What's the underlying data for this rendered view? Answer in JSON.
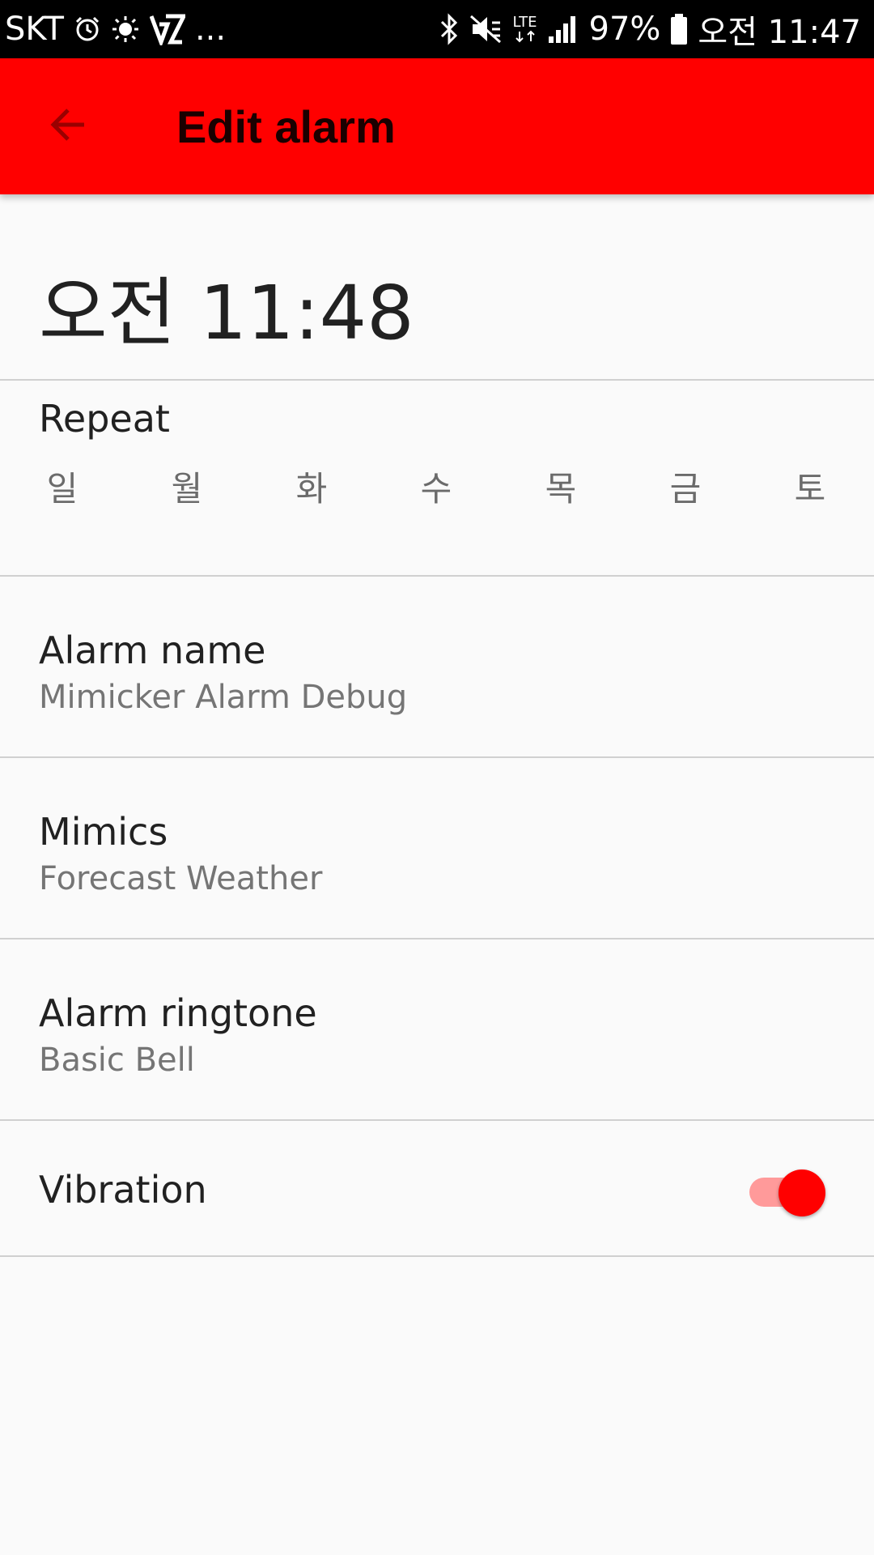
{
  "status_bar": {
    "carrier": "SKT",
    "more": "...",
    "network": "LTE",
    "battery": "97%",
    "time": "오전 11:47",
    "icons": [
      "alarm-icon",
      "brightness-icon",
      "app-icon",
      "bluetooth-icon",
      "mute-icon",
      "lte-icon",
      "signal-icon",
      "battery-icon"
    ]
  },
  "app_bar": {
    "title": "Edit alarm",
    "back_icon": "arrow-back-icon",
    "color": "#ff0000"
  },
  "alarm_time": "오전 11:48",
  "repeat": {
    "label": "Repeat",
    "days": [
      "일",
      "월",
      "화",
      "수",
      "목",
      "금",
      "토"
    ]
  },
  "alarm_name": {
    "title": "Alarm name",
    "value": "Mimicker Alarm Debug"
  },
  "mimics": {
    "title": "Mimics",
    "value": "Forecast Weather"
  },
  "ringtone": {
    "title": "Alarm ringtone",
    "value": "Basic Bell"
  },
  "vibration": {
    "label": "Vibration",
    "enabled": true,
    "accent": "#ff0000"
  }
}
